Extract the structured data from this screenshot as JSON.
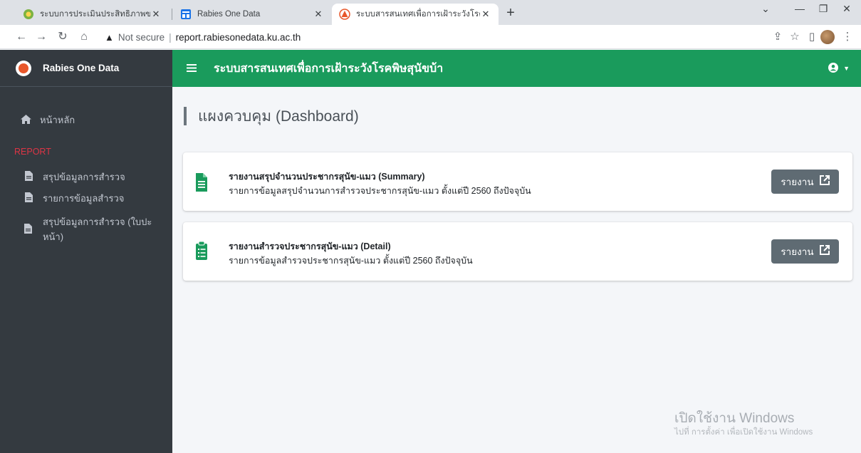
{
  "browser": {
    "tabs": [
      {
        "title": "ระบบการประเมินประสิทธิภาพขององค์ก"
      },
      {
        "title": "Rabies One Data"
      },
      {
        "title": "ระบบสารสนเทศเพื่อการเฝ้าระวังโรคพิษ"
      }
    ],
    "new_tab": "+",
    "address": {
      "security_label": "Not secure",
      "url": "report.rabiesonedata.ku.ac.th"
    }
  },
  "brand": {
    "name": "Rabies One Data",
    "accent": "#1a9b5c"
  },
  "header": {
    "title": "ระบบสารสนเทศเพื่อการเฝ้าระวังโรคพิษสุนัขบ้า"
  },
  "sidebar": {
    "home": {
      "label": "หน้าหลัก",
      "icon": "home-icon"
    },
    "section_header": "REPORT",
    "items": [
      {
        "label": "สรุปข้อมูลการสำรวจ",
        "icon": "file-icon"
      },
      {
        "label": "รายการข้อมูลสำรวจ",
        "icon": "file-icon"
      },
      {
        "label": "สรุปข้อมูลการสำรวจ (ใบปะหน้า)",
        "icon": "file-icon"
      }
    ]
  },
  "page": {
    "title": "แผงควบคุม (Dashboard)"
  },
  "cards": [
    {
      "title": "รายงานสรุปจำนวนประชากรสุนัข-แมว (Summary)",
      "subtitle": "รายการข้อมูลสรุปจำนวนการสำรวจประชากรสุนัข-แมว ตั้งแต่ปี 2560 ถึงปัจจุบัน",
      "button": "รายงาน"
    },
    {
      "title": "รายงานสำรวจประชากรสุนัข-แมว (Detail)",
      "subtitle": "รายการข้อมูลสำรวจประชากรสุนัข-แมว ตั้งแต่ปี 2560 ถึงปัจจุบัน",
      "button": "รายงาน"
    }
  ],
  "watermark": {
    "line1": "เปิดใช้งาน Windows",
    "line2": "ไปที่ การตั้งค่า เพื่อเปิดใช้งาน Windows"
  }
}
